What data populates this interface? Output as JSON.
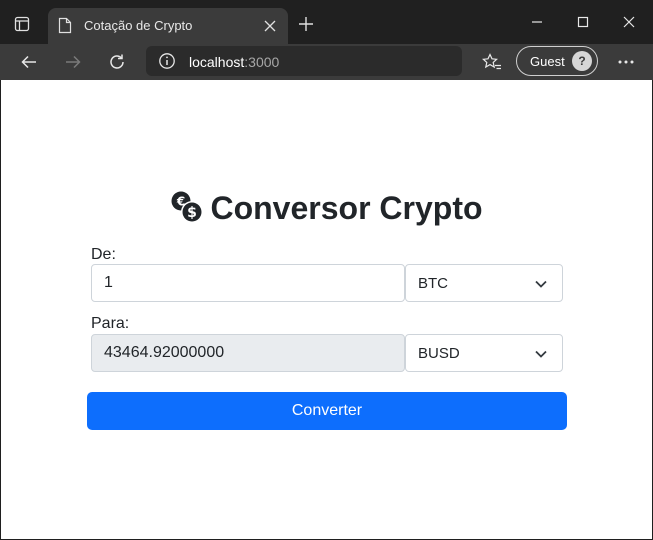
{
  "browser": {
    "tab_title": "Cotação de Crypto",
    "address_host": "localhost",
    "address_port": ":3000",
    "profile_label": "Guest"
  },
  "page": {
    "title": "Conversor Crypto",
    "from_label": "De:",
    "from_amount": "1",
    "from_currency": "BTC",
    "to_label": "Para:",
    "to_amount": "43464.92000000",
    "to_currency": "BUSD",
    "convert_label": "Converter"
  },
  "colors": {
    "primary": "#0d6efd",
    "readonly_bg": "#e9ecef",
    "text": "#212529"
  },
  "icons": {
    "tab_actions": "tab-actions-icon",
    "favicon": "page-icon",
    "close": "close-icon",
    "new_tab": "plus-icon",
    "back": "arrow-left-icon",
    "forward": "arrow-right-icon",
    "reload": "reload-icon",
    "info": "info-icon",
    "favorites": "star-list-icon",
    "more": "more-icon",
    "heading": "coins-icon",
    "select": "chevron-down-icon"
  }
}
